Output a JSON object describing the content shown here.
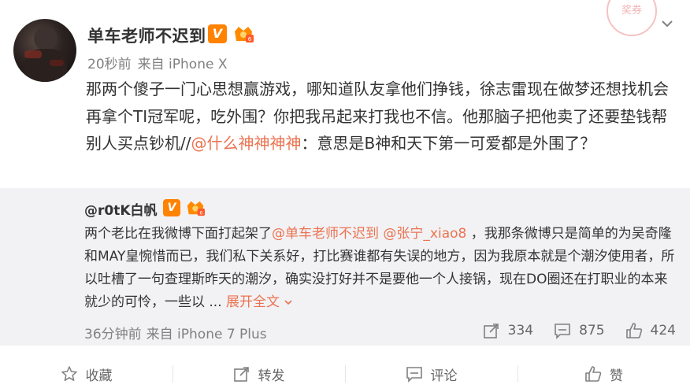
{
  "post": {
    "author": "单车老师不迟到",
    "time": "20秒前",
    "source": "来自 iPhone X",
    "text_before": "那两个傻子一门心思想赢游戏，哪知道队友拿他们挣钱，徐志雷现在做梦还想找机会再拿个TI冠军呢，吃外围？你把我吊起来打我也不信。他那脑子把他卖了还要垫钱帮别人买点钞机//",
    "mention": "@什么神神神神",
    "text_after": "：意思是B神和天下第一可爱都是外围了？",
    "stamp_text": "奖券"
  },
  "repost": {
    "author": "@r0tK白帆",
    "text_1": "两个老比在我微博下面打起架了",
    "mention_1": "@单车老师不迟到",
    "mention_2": "@张宁_xiao8",
    "text_2": "，我那条微博只是简单的为吴奇隆和MAY皇惋惜而已，我们私下关系好，打比赛谁都有失误的地方，因为我原本就是个潮汐使用者，所以吐槽了一句查理斯昨天的潮汐，确实没打好并不是要他一个人接锅，现在DO圈还在打职业的本来就少的可怜，一些以 ...",
    "expand": "展开全文",
    "time": "36分钟前",
    "source": "来自 iPhone 7 Plus",
    "reposts": "334",
    "comments": "875",
    "likes": "424"
  },
  "actions": {
    "favorite": "收藏",
    "repost": "转发",
    "comment": "评论",
    "like": "赞"
  },
  "colors": {
    "accent": "#eb7350",
    "verified": "#ff8200",
    "repost_bg": "#f2f2f5"
  }
}
